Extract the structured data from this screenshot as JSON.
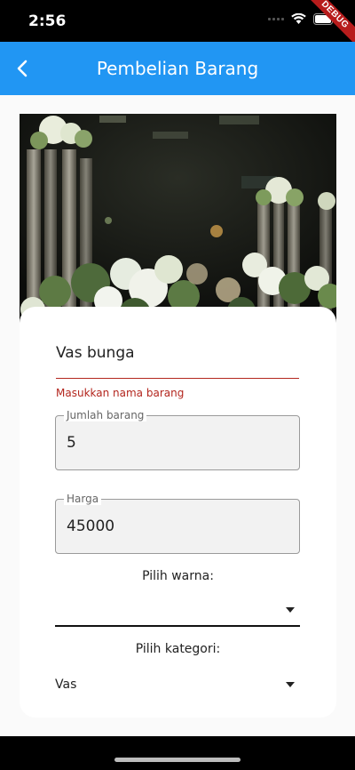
{
  "status_bar": {
    "time": "2:56",
    "debug_banner": "DEBUG"
  },
  "app_bar": {
    "title": "Pembelian Barang",
    "back_icon": "arrow-back-icon",
    "color": "#2196f3"
  },
  "form": {
    "name": {
      "value": "Vas bunga",
      "error": "Masukkan nama barang"
    },
    "quantity": {
      "label": "Jumlah barang",
      "value": "5"
    },
    "price": {
      "label": "Harga",
      "value": "45000"
    },
    "color_select": {
      "label": "Pilih warna:",
      "value": ""
    },
    "category_select": {
      "label": "Pilih kategori:",
      "value": "Vas"
    }
  },
  "colors": {
    "error": "#b3261e",
    "appbar": "#2196f3"
  }
}
